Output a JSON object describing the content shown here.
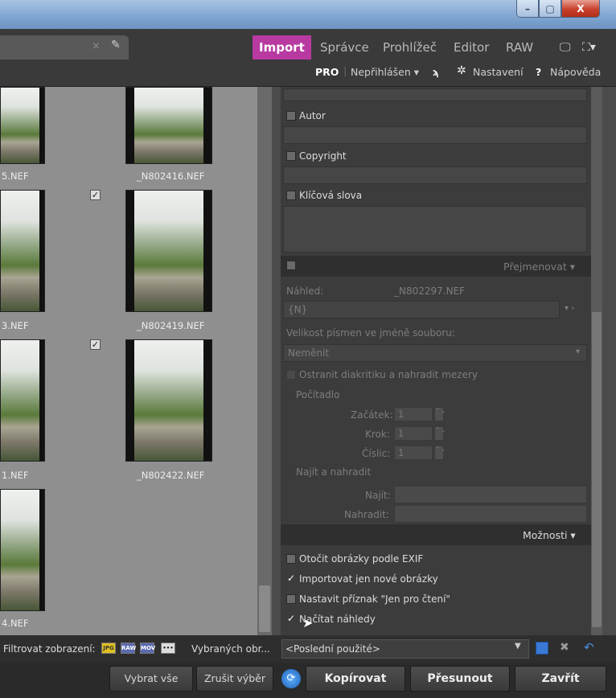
{
  "window": {
    "min": "–",
    "max": "▢",
    "close": "X"
  },
  "nav": {
    "import": "Import",
    "spravce": "Správce",
    "prohlizec": "Prohlížeč",
    "editor": "Editor",
    "raw": "RAW",
    "monitor_icon": "monitor-icon",
    "fullscreen_icon": "fullscreen-icon"
  },
  "status": {
    "pro": "PRO",
    "login": "Nepřihlášen ▾",
    "rss_icon": "rss-icon",
    "settings": "Nastavení",
    "help_mark": "?",
    "help": "Nápověda"
  },
  "gallery": {
    "files": [
      "5.NEF",
      "_N802416.NEF",
      "3.NEF",
      "_N802419.NEF",
      "1.NEF",
      "_N802422.NEF",
      "4.NEF"
    ],
    "check": "✓"
  },
  "panel": {
    "autor": "Autor",
    "copyright": "Copyright",
    "keywords": "Klíčová slova",
    "rename_header": "Přejmenovat ▾",
    "preview_label": "Náhled:",
    "preview_value": "_N802297.NEF",
    "pattern": "{N}",
    "case_label": "Velikost písmen ve jméně souboru:",
    "case_value": "Neměnit",
    "remove_diacritics": "Ostranit diakritiku a nahradit mezery",
    "counter_legend": "Počítadlo",
    "start_label": "Začátek:",
    "start_value": "1",
    "step_label": "Krok:",
    "step_value": "1",
    "digits_label": "Číslic:",
    "digits_value": "1",
    "findreplace_legend": "Najít a nahradit",
    "find_label": "Najít:",
    "replace_label": "Nahradit:",
    "options_header": "Možnosti ▾",
    "opt_rotate": "Otočit obrázky podle EXIF",
    "opt_new_only": "Importovat jen nové obrázky",
    "opt_readonly": "Nastavit příznak \"Jen pro čtení\"",
    "opt_previews": "Načítat náhledy"
  },
  "filter": {
    "label": "Filtrovat zobrazení:",
    "jpg": "JPG",
    "raw": "RAW",
    "mov": "MOV",
    "more": "•••",
    "selected": "Vybraných obr...",
    "preset": "<Poslední použité>"
  },
  "actions": {
    "select_all": "Vybrat vše",
    "deselect": "Zrušit výběr",
    "copy": "Kopírovat",
    "move": "Přesunout",
    "close": "Zavřít"
  },
  "colors": {
    "accent": "#b83aa0"
  }
}
